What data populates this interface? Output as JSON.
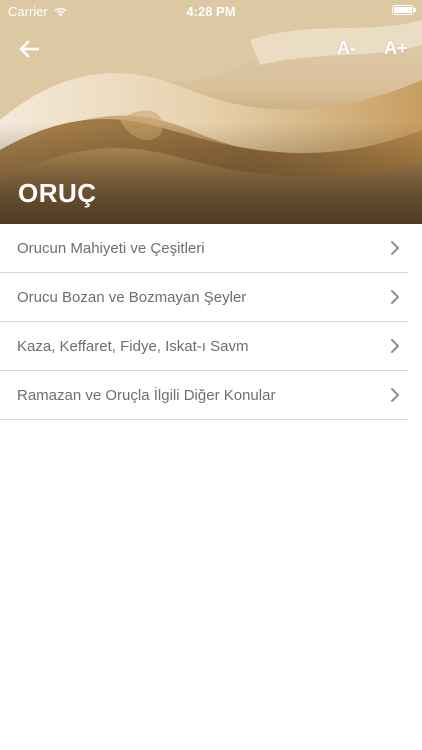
{
  "status_bar": {
    "carrier": "Carrier",
    "time": "4:28 PM",
    "wifi_icon": "wifi-icon",
    "battery_icon": "battery-icon"
  },
  "header": {
    "back_icon": "arrow-left-icon",
    "font_decrease_label": "A-",
    "font_increase_label": "A+",
    "title": "ORUÇ",
    "accent_color": "#b58d55"
  },
  "topics": [
    {
      "label": "Orucun Mahiyeti ve Çeşitleri"
    },
    {
      "label": "Orucu Bozan ve Bozmayan Şeyler"
    },
    {
      "label": "Kaza, Keffaret, Fidye, Iskat-ı Savm"
    },
    {
      "label": "Ramazan ve Oruçla İlgili Diğer Konular"
    }
  ],
  "chevron_icon": "chevron-right-icon"
}
